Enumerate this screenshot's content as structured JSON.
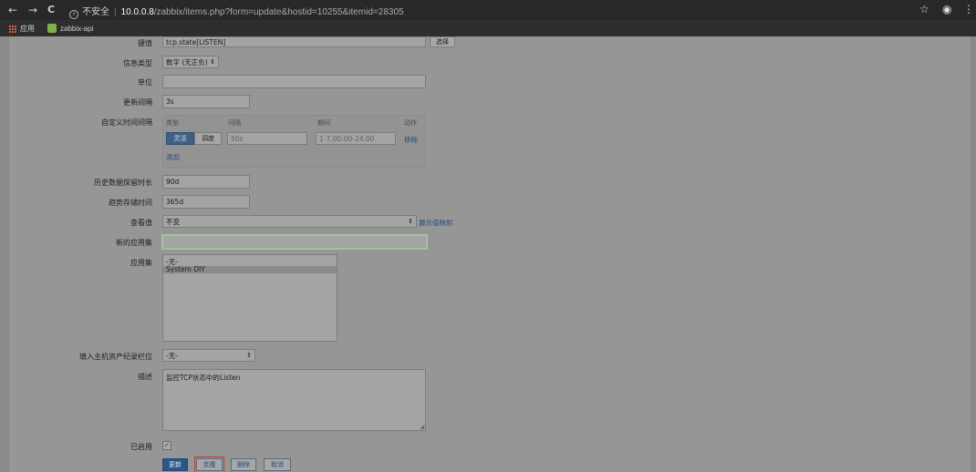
{
  "browser": {
    "back_icon": "←",
    "forward_icon": "→",
    "reload_icon": "C",
    "security_label": "不安全",
    "url_host": "10.0.0.8",
    "url_path": "/zabbix/items.php?form=update&hostid=10255&itemid=28305",
    "star_icon": "☆",
    "account_icon": "◉",
    "menu_icon": "⋮",
    "bookmarks": [
      "应用",
      "zabbix-api"
    ]
  },
  "form": {
    "key": {
      "label": "键值",
      "value": "tcp.state[LISTEN]",
      "select_button": "选择"
    },
    "info_type": {
      "label": "信息类型",
      "value": "数字 (无正负)"
    },
    "units": {
      "label": "单位",
      "value": ""
    },
    "update_interval": {
      "label": "更新间隔",
      "value": "3s"
    },
    "custom_intervals": {
      "label": "自定义时间间隔",
      "headers": {
        "type": "类型",
        "interval": "间隔",
        "period": "期间",
        "action": "动作"
      },
      "type_flexible": "灵活",
      "type_scheduling": "调度",
      "interval_placeholder": "50s",
      "period_placeholder": "1-7,00:00-24:00",
      "remove_link": "移除",
      "add_link": "添加"
    },
    "history": {
      "label": "历史数据保留时长",
      "value": "90d"
    },
    "trends": {
      "label": "趋势存储时间",
      "value": "365d"
    },
    "show_value": {
      "label": "查看值",
      "value": "不变",
      "mapping_link": "展示值映射"
    },
    "new_application": {
      "label": "新的应用集",
      "value": ""
    },
    "applications": {
      "label": "应用集",
      "options": [
        "-无-",
        "System DIY"
      ],
      "selected": "System DIY"
    },
    "inventory": {
      "label": "填入主机资产纪录栏位",
      "value": "-无-"
    },
    "description": {
      "label": "描述",
      "value": "监控TCP状态中的Listen"
    },
    "enabled": {
      "label": "已启用",
      "checked": true,
      "check_mark": "✓"
    },
    "buttons": {
      "update": "更新",
      "clone": "克隆",
      "delete": "删除",
      "cancel": "取消"
    }
  }
}
